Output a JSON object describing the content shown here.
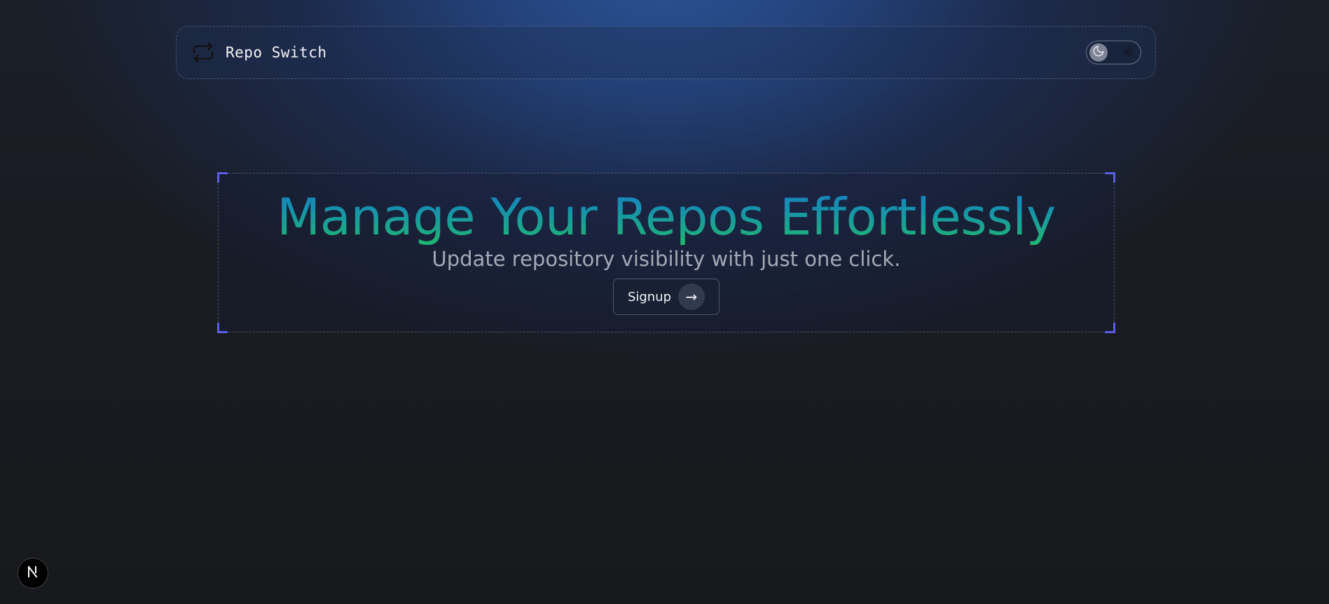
{
  "navbar": {
    "brand_title": "Repo Switch",
    "logo_icon": "repeat-arrows-icon",
    "theme_toggle": {
      "options": [
        "dark",
        "light"
      ],
      "selected": "dark",
      "dark_icon": "moon-icon",
      "light_icon": "sun-icon"
    }
  },
  "hero": {
    "title": "Manage Your Repos Effortlessly",
    "subtitle": "Update repository visibility with just one click.",
    "cta_label": "Signup",
    "cta_arrow": "→"
  },
  "dev_badge": {
    "icon": "nextjs-logo-icon"
  },
  "colors": {
    "title_gradient_top": "#1f6fd0",
    "title_gradient_bottom": "#1fb86e",
    "corner_accent": "#5b5ee6",
    "background_glow": "#2b5194"
  }
}
